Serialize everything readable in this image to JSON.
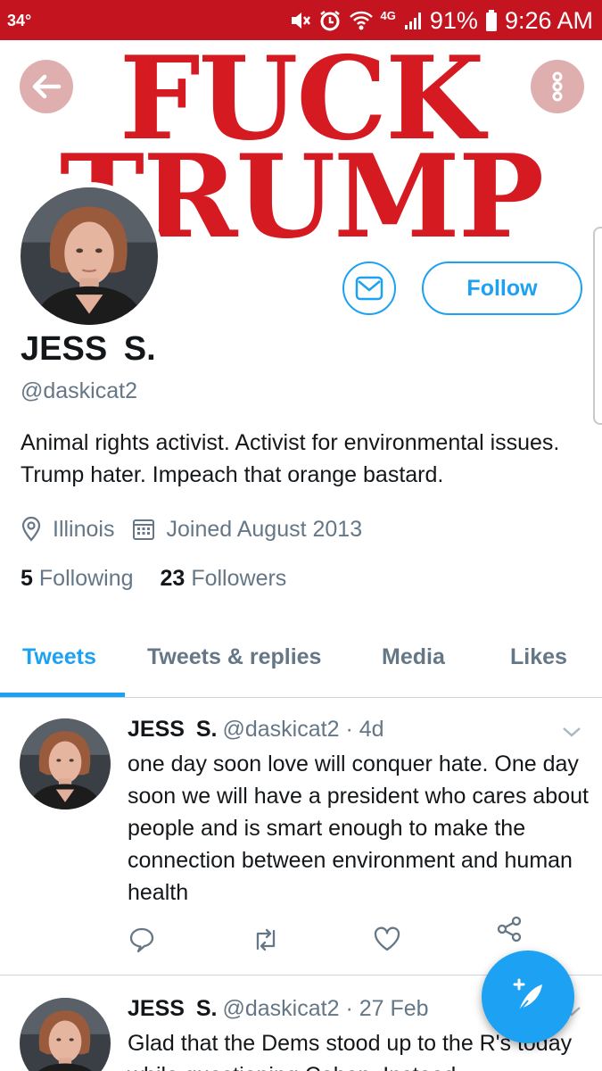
{
  "status_bar": {
    "temperature": "34°",
    "network_label": "4G",
    "battery": "91%",
    "time": "9:26 AM"
  },
  "banner": {
    "line1": "FUCK",
    "line2": "TRUMP",
    "text_color": "#d61a22"
  },
  "profile": {
    "display_name": "JESS  S.",
    "handle": "@daskicat2",
    "bio": "Animal rights activist. Activist for environmental issues. Trump hater. Impeach that orange bastard.",
    "location": "Illinois",
    "joined": "Joined August 2013",
    "following_count": "5",
    "following_label": "Following",
    "followers_count": "23",
    "followers_label": "Followers",
    "follow_button": "Follow",
    "icons": {
      "location": "location-pin-icon",
      "joined": "calendar-icon",
      "message": "envelope-icon"
    }
  },
  "tabs": [
    {
      "label": "Tweets",
      "active": true
    },
    {
      "label": "Tweets & replies",
      "active": false
    },
    {
      "label": "Media",
      "active": false
    },
    {
      "label": "Likes",
      "active": false
    }
  ],
  "tweets": [
    {
      "name": "JESS  S.",
      "handle": "@daskicat2",
      "time": "· 4d",
      "text": "one day soon love will conquer hate. One day soon we will have a president who cares about people and is smart enough to make the connection between environment and human health"
    },
    {
      "name": "JESS  S.",
      "handle": "@daskicat2",
      "time": "· 27 Feb",
      "text": "Glad that the Dems stood up to the R's today while questioning Cohen. Instead"
    }
  ],
  "colors": {
    "status_bar": "#c41420",
    "accent": "#1da1f2",
    "secondary_text": "#657786",
    "primary_text": "#14171a"
  }
}
